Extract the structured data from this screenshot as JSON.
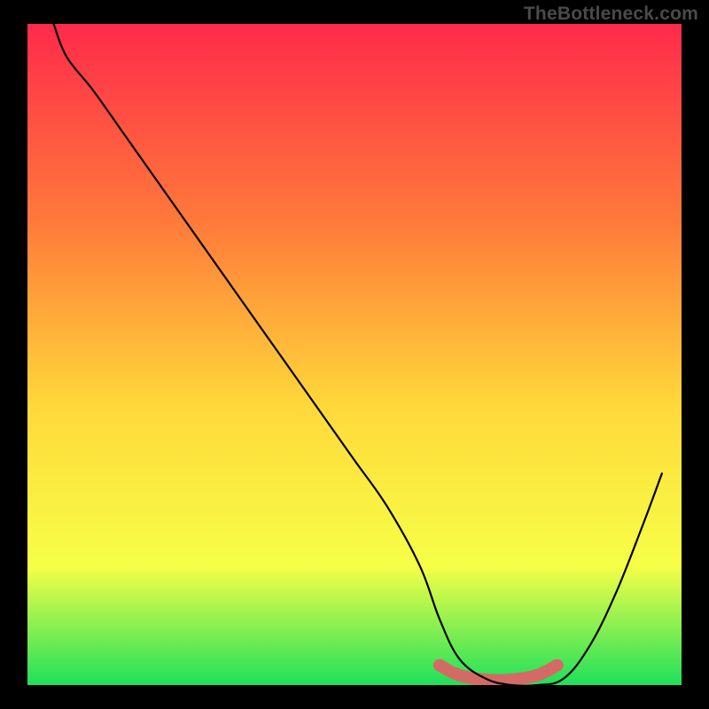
{
  "watermark": "TheBottleneck.com",
  "chart_data": {
    "type": "line",
    "title": "",
    "xlabel": "",
    "ylabel": "",
    "xlim": [
      0,
      100
    ],
    "ylim": [
      0,
      100
    ],
    "grid": false,
    "legend": false,
    "background_gradient": {
      "top": "#ff2a4b",
      "mid_upper": "#ff7a3a",
      "mid": "#ffd93a",
      "mid_lower": "#f6ff47",
      "bottom": "#1fe05a"
    },
    "series": [
      {
        "name": "curve",
        "color": "#000000",
        "x": [
          4,
          6,
          10,
          15,
          20,
          25,
          30,
          35,
          40,
          45,
          50,
          55,
          60,
          63,
          66,
          70,
          74,
          78,
          82,
          86,
          90,
          94,
          97
        ],
        "y": [
          100,
          95,
          90,
          83,
          76,
          69,
          62,
          55,
          48,
          41,
          34,
          27,
          18,
          10,
          4,
          1,
          0,
          0,
          1,
          6,
          14,
          24,
          32
        ]
      },
      {
        "name": "highlight-band",
        "color": "#d46a66",
        "x": [
          63,
          66,
          70,
          74,
          78,
          81
        ],
        "y": [
          3.0,
          1.5,
          0.8,
          0.8,
          1.5,
          3.0
        ]
      }
    ],
    "annotations": []
  }
}
